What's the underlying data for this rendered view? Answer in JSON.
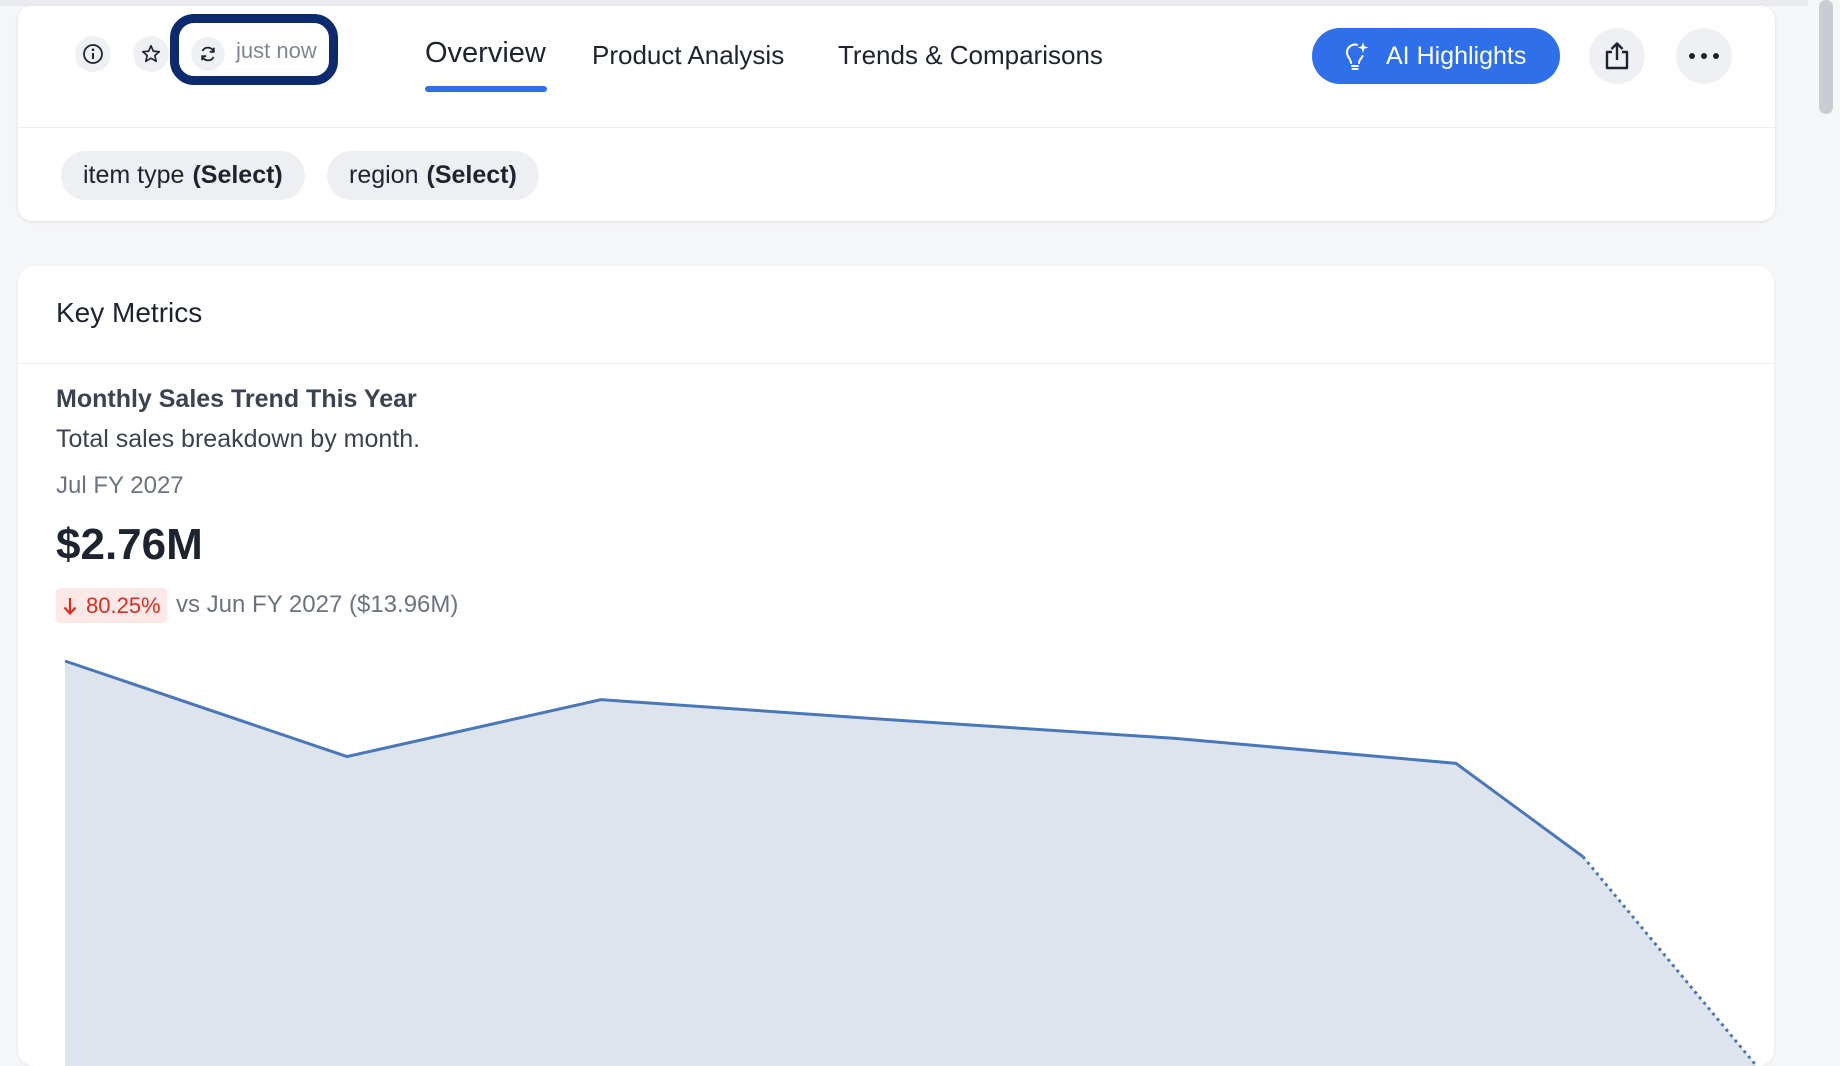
{
  "header": {
    "refresh_label": "just now",
    "tabs": [
      {
        "label": "Overview",
        "active": true
      },
      {
        "label": "Product Analysis",
        "active": false
      },
      {
        "label": "Trends & Comparisons",
        "active": false
      }
    ],
    "ai_button_label": "AI Highlights",
    "icons": [
      "info-icon",
      "star-icon",
      "refresh-icon",
      "sparkle-bulb-icon",
      "share-icon",
      "more-icon"
    ]
  },
  "filters": [
    {
      "name": "item type",
      "value": "(Select)"
    },
    {
      "name": "region",
      "value": "(Select)"
    }
  ],
  "section": {
    "title": "Key Metrics"
  },
  "kpi": {
    "title": "Monthly Sales Trend This Year",
    "subtitle": "Total sales breakdown by month.",
    "period": "Jul FY 2027",
    "value": "$2.76M",
    "delta": "80.25%",
    "delta_direction": "down",
    "comparison": "vs Jun FY 2027 ($13.96M)"
  },
  "chart_data": {
    "type": "area",
    "values_relative": [
      1.0,
      0.79,
      0.915,
      0.87,
      0.83,
      0.775,
      0.57,
      0.0
    ],
    "projected_from_index": 6,
    "colors": {
      "line": "#4a77b8",
      "fill": "#dde4ee"
    }
  },
  "colors": {
    "accent": "#2f6fea",
    "highlight_ring": "#0d2a6e",
    "negative": "#d92d20"
  }
}
